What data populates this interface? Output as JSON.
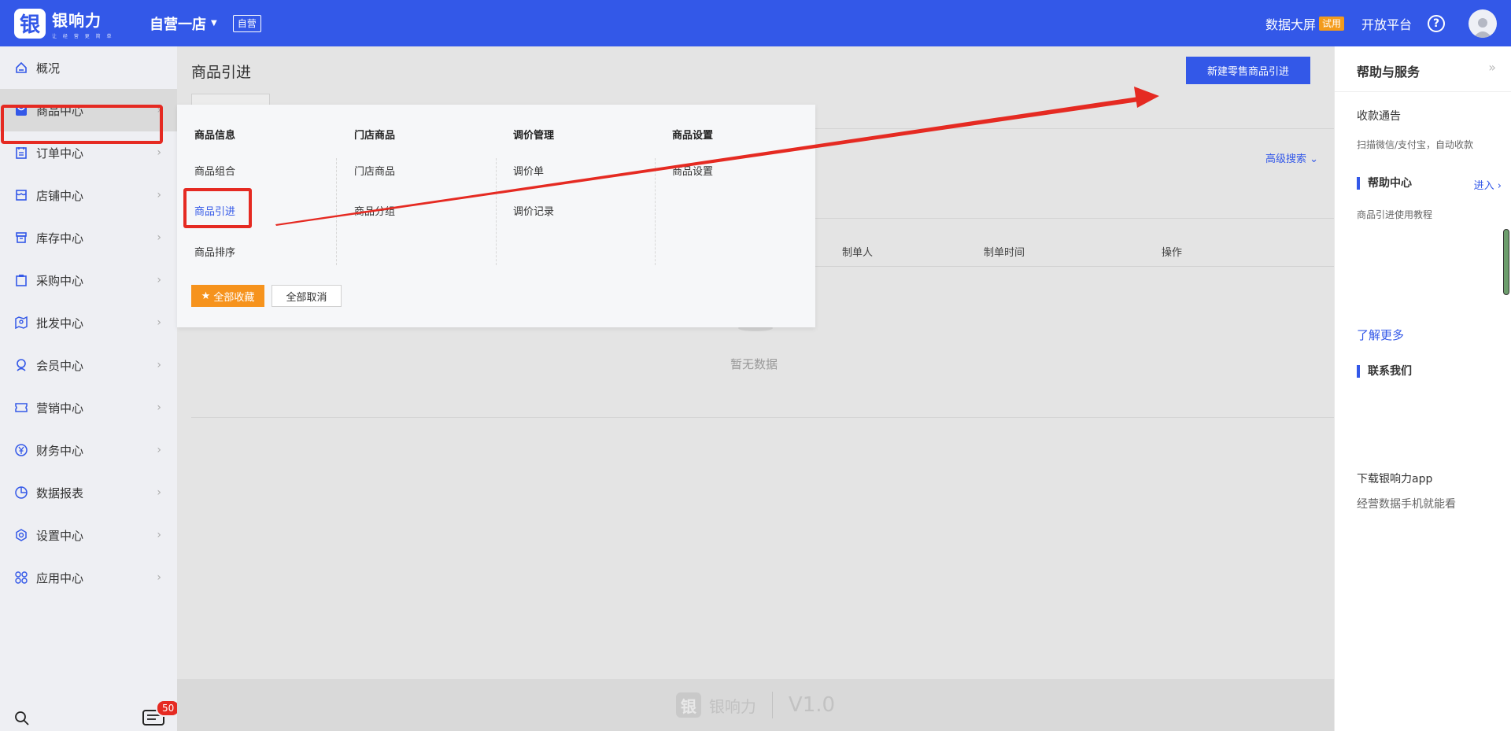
{
  "header": {
    "logo_char": "银",
    "logo_name": "银响力",
    "logo_slogan": "让 经 营 更 简 单",
    "store_name": "自营一店",
    "store_tag": "自营",
    "data_screen": "数据大屏",
    "trial_badge": "试用",
    "open_platform": "开放平台",
    "help_mark": "?"
  },
  "sidebar": {
    "items": [
      {
        "label": "概况",
        "icon": "home-icon"
      },
      {
        "label": "商品中心",
        "icon": "bag-icon"
      },
      {
        "label": "订单中心",
        "icon": "order-icon"
      },
      {
        "label": "店铺中心",
        "icon": "shop-icon"
      },
      {
        "label": "库存中心",
        "icon": "inventory-icon"
      },
      {
        "label": "采购中心",
        "icon": "clipboard-icon"
      },
      {
        "label": "批发中心",
        "icon": "map-icon"
      },
      {
        "label": "会员中心",
        "icon": "member-icon"
      },
      {
        "label": "营销中心",
        "icon": "ticket-icon"
      },
      {
        "label": "财务中心",
        "icon": "yen-icon"
      },
      {
        "label": "数据报表",
        "icon": "pie-icon"
      },
      {
        "label": "设置中心",
        "icon": "hexagon-icon"
      },
      {
        "label": "应用中心",
        "icon": "apps-icon"
      }
    ],
    "message_count": "50"
  },
  "main": {
    "page_title": "商品引进",
    "new_button": "新建零售商品引进",
    "advanced_search": "高级搜索",
    "table_headers": [
      "制单人",
      "制单时间",
      "操作"
    ],
    "empty_text": "暂无数据"
  },
  "dropdown": {
    "columns": [
      {
        "heading": "商品信息",
        "items": [
          "商品组合",
          "商品引进",
          "商品排序"
        ]
      },
      {
        "heading": "门店商品",
        "items": [
          "门店商品",
          "商品分组"
        ]
      },
      {
        "heading": "调价管理",
        "items": [
          "调价单",
          "调价记录"
        ]
      },
      {
        "heading": "商品设置",
        "items": [
          "商品设置"
        ]
      }
    ],
    "fav_all": "全部收藏",
    "cancel_all": "全部取消"
  },
  "footer": {
    "mark": "银",
    "name": "银响力",
    "version": "V1.0"
  },
  "right_panel": {
    "title": "帮助与服务",
    "notice_title": "收款通告",
    "notice_desc": "扫描微信/支付宝，自动收款",
    "help_center": "帮助中心",
    "enter": "进入",
    "tutorial": "商品引进使用教程",
    "learn_more": "了解更多",
    "contact": "联系我们",
    "download_app": "下载银响力app",
    "download_desc": "经营数据手机就能看"
  },
  "colors": {
    "brand_blue": "#3358e8",
    "annotation_red": "#e52a22",
    "trial_orange": "#f39b1c"
  }
}
